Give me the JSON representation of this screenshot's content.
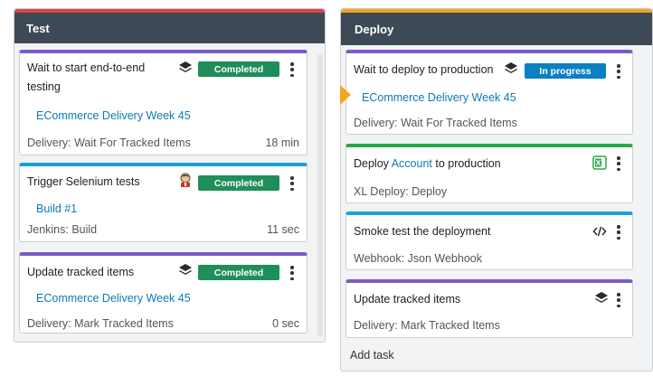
{
  "columns": {
    "test": {
      "title": "Test",
      "color": "#d94848",
      "cards": [
        {
          "title_line1": "Wait to start end-to-end",
          "title_line2": "testing",
          "status": "Completed",
          "link": "ECommerce Delivery Week 45",
          "meta": "Delivery: Wait For Tracked Items",
          "duration": "18 min",
          "icon": "layers-icon",
          "stripe_color": "#7b5cc7"
        },
        {
          "title": "Trigger Selenium tests",
          "status": "Completed",
          "link": "Build #1",
          "meta": "Jenkins: Build",
          "duration": "11 sec",
          "icon": "jenkins-avatar-icon",
          "stripe_color": "#1aa3d4"
        },
        {
          "title": "Update tracked items",
          "status": "Completed",
          "link": "ECommerce Delivery Week 45",
          "meta": "Delivery: Mark Tracked Items",
          "duration": "0 sec",
          "icon": "layers-icon",
          "stripe_color": "#7b5cc7"
        }
      ]
    },
    "deploy": {
      "title": "Deploy",
      "color": "#f3a51d",
      "cards": [
        {
          "title": "Wait to deploy to production",
          "status": "In progress",
          "link": "ECommerce Delivery Week 45",
          "meta": "Delivery: Wait For Tracked Items",
          "icon": "layers-icon",
          "stripe_color": "#7b5cc7"
        },
        {
          "title_prefix": "Deploy ",
          "title_link": "Account",
          "title_suffix": " to production",
          "meta": "XL Deploy: Deploy",
          "icon": "xl-deploy-icon",
          "stripe_color": "#27a84b"
        },
        {
          "title": "Smoke test the deployment",
          "meta": "Webhook: Json Webhook",
          "icon": "code-icon",
          "stripe_color": "#1aa3d4"
        },
        {
          "title": "Update tracked items",
          "meta": "Delivery: Mark Tracked Items",
          "icon": "layers-icon",
          "stripe_color": "#7b5cc7"
        }
      ],
      "add_task": "Add task"
    }
  }
}
